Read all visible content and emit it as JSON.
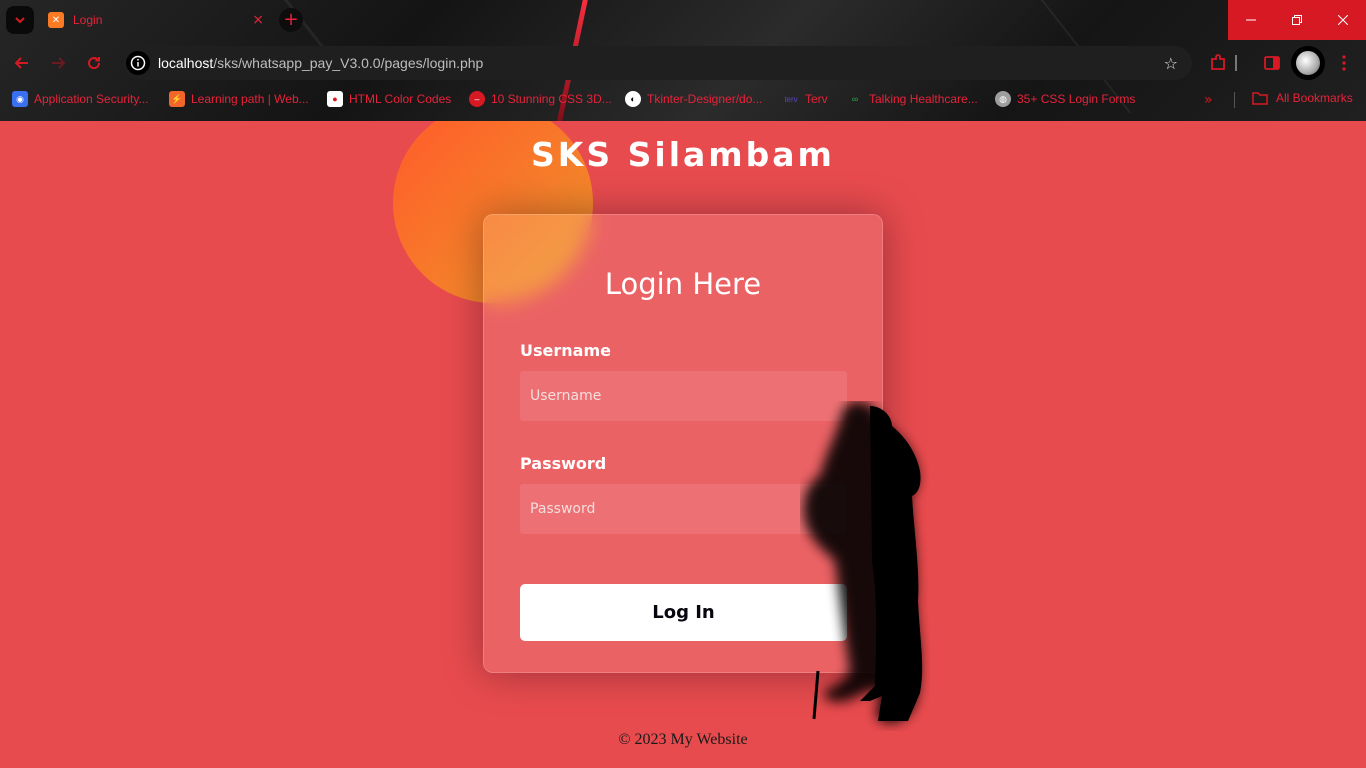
{
  "browser": {
    "tab": {
      "title": "Login",
      "close_icon": "×"
    },
    "new_tab_icon": "+",
    "url": {
      "host": "localhost",
      "path": "/sks/whatsapp_pay_V3.0.0/pages/login.php"
    },
    "bookmarks": [
      {
        "label": "Application Security...",
        "icon_color": "#3a6ff0"
      },
      {
        "label": "Learning path | Web...",
        "icon_color": "#f2652b"
      },
      {
        "label": "HTML Color Codes",
        "icon_color": "#ffffff"
      },
      {
        "label": "10 Stunning CSS 3D...",
        "icon_color": "#d71924"
      },
      {
        "label": "Tkinter-Designer/do...",
        "icon_color": "#ffffff"
      },
      {
        "label": "Terv",
        "icon_color": "#5a45c8"
      },
      {
        "label": "Talking Healthcare...",
        "icon_color": "#2fa84f"
      },
      {
        "label": "35+ CSS Login Forms",
        "icon_color": "#9e9e9e"
      }
    ],
    "all_bookmarks": "All Bookmarks",
    "accent": "#d71924"
  },
  "page": {
    "brand": "SKS Silambam",
    "form": {
      "title": "Login Here",
      "username_label": "Username",
      "username_placeholder": "Username",
      "password_label": "Password",
      "password_placeholder": "Password",
      "submit_label": "Log In"
    },
    "footer": "© 2023 My Website",
    "background": "#e84b4e"
  }
}
